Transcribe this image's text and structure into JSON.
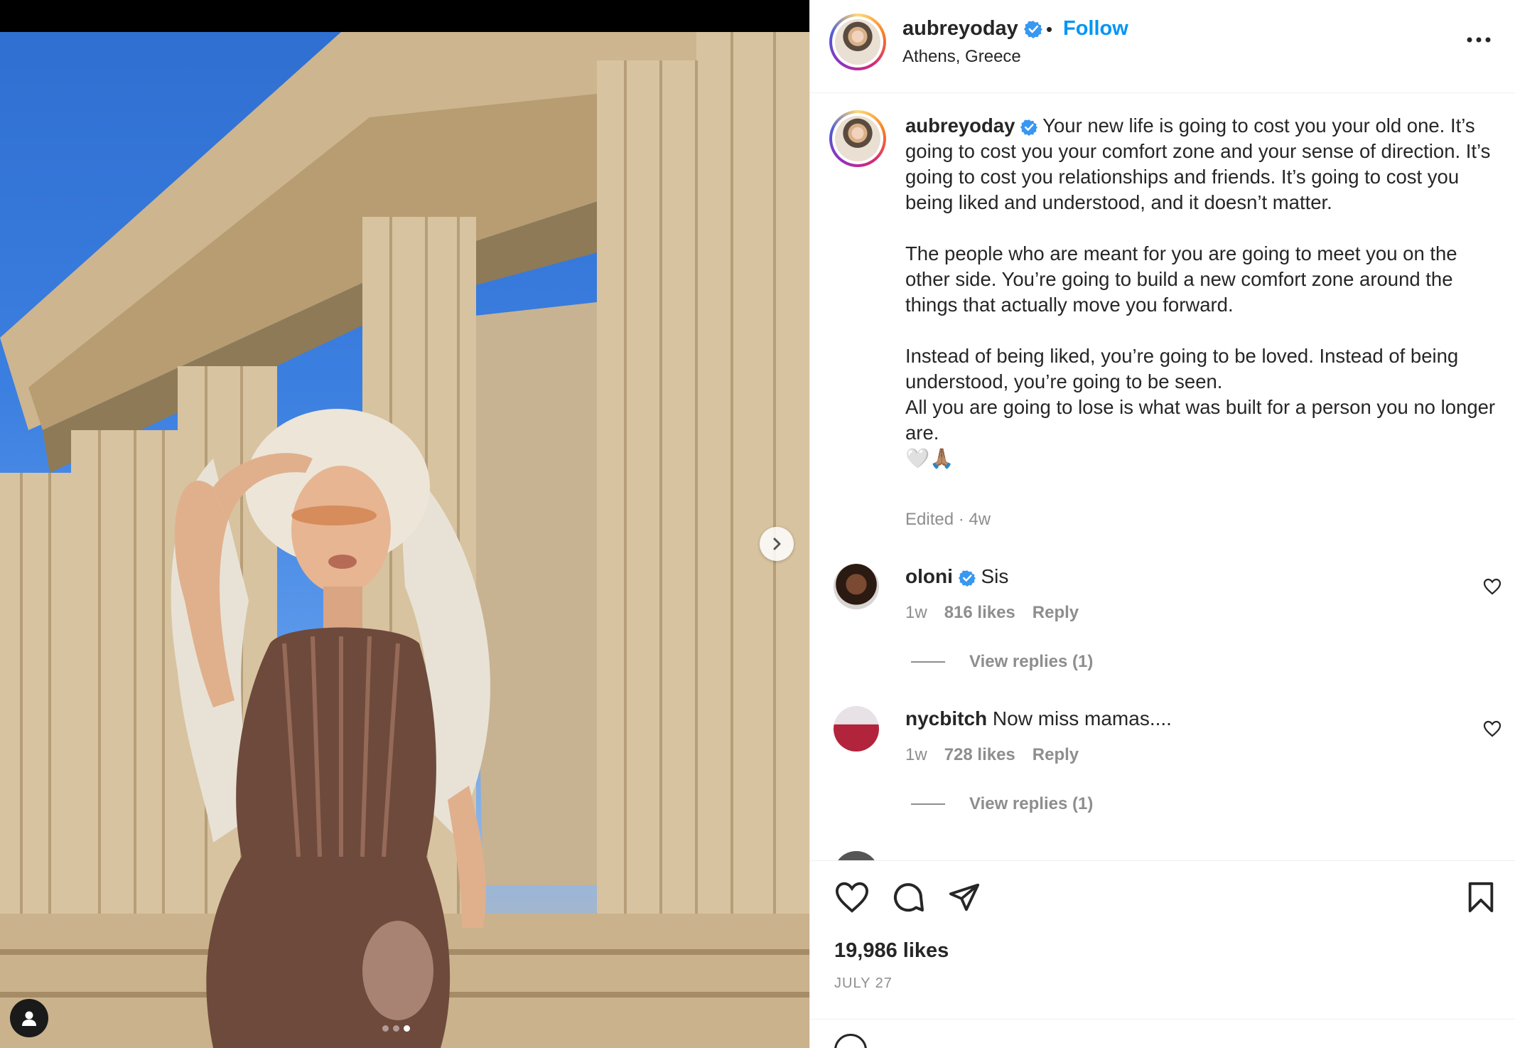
{
  "post": {
    "author": "aubreyoday",
    "location": "Athens, Greece",
    "follow_label": "Follow",
    "separator": "•",
    "verified": true
  },
  "caption": {
    "author": "aubreyoday",
    "paragraphs": [
      "Your new life is going to cost you your old one. It’s going to cost you your comfort zone and your sense of direction. It’s going to cost you relationships and friends. It’s going to cost you being liked and understood, and it doesn’t matter.",
      "The people who are meant for you are going to meet you on the other side. You’re going to build a new comfort zone around the things that actually move you forward.",
      "Instead of being liked, you’re going to be loved. Instead of being understood, you’re going to be seen.",
      "All you are going to lose is what was built for a person you no longer are.",
      "🤍🙏🏽"
    ],
    "meta": "Edited · 4w"
  },
  "comments": [
    {
      "username": "oloni",
      "verified": true,
      "text": "Sis",
      "time": "1w",
      "likes": "816 likes",
      "reply_label": "Reply",
      "view_replies": "View replies (1)"
    },
    {
      "username": "nycbitch",
      "verified": false,
      "text": "Now miss mamas....",
      "time": "1w",
      "likes": "728 likes",
      "reply_label": "Reply",
      "view_replies": "View replies (1)"
    }
  ],
  "actions": {
    "likes": "19,986 likes",
    "date": "JULY 27",
    "icons": [
      "heart-icon",
      "comment-icon",
      "share-icon",
      "bookmark-icon"
    ]
  },
  "media": {
    "carousel_count": 3,
    "carousel_active_index": 2
  },
  "colors": {
    "accent": "#0095f6",
    "verified": "#3897f0",
    "text": "#262626",
    "muted": "#8e8e8e"
  }
}
